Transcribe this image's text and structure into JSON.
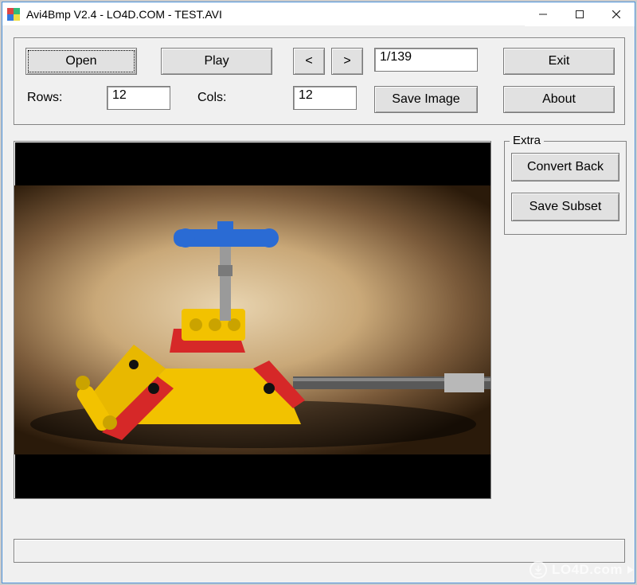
{
  "titlebar": {
    "title": "Avi4Bmp V2.4 - LO4D.COM - TEST.AVI"
  },
  "toolbar": {
    "open": "Open",
    "play": "Play",
    "prev": "<",
    "next": ">",
    "frame_counter": "1/139",
    "exit": "Exit",
    "rows_label": "Rows:",
    "rows_value": "12",
    "cols_label": "Cols:",
    "cols_value": "12",
    "save_image": "Save Image",
    "about": "About"
  },
  "extra": {
    "group_label": "Extra",
    "convert_back": "Convert Back",
    "save_subset": "Save Subset"
  },
  "watermark": {
    "text": "LO4D.com"
  }
}
